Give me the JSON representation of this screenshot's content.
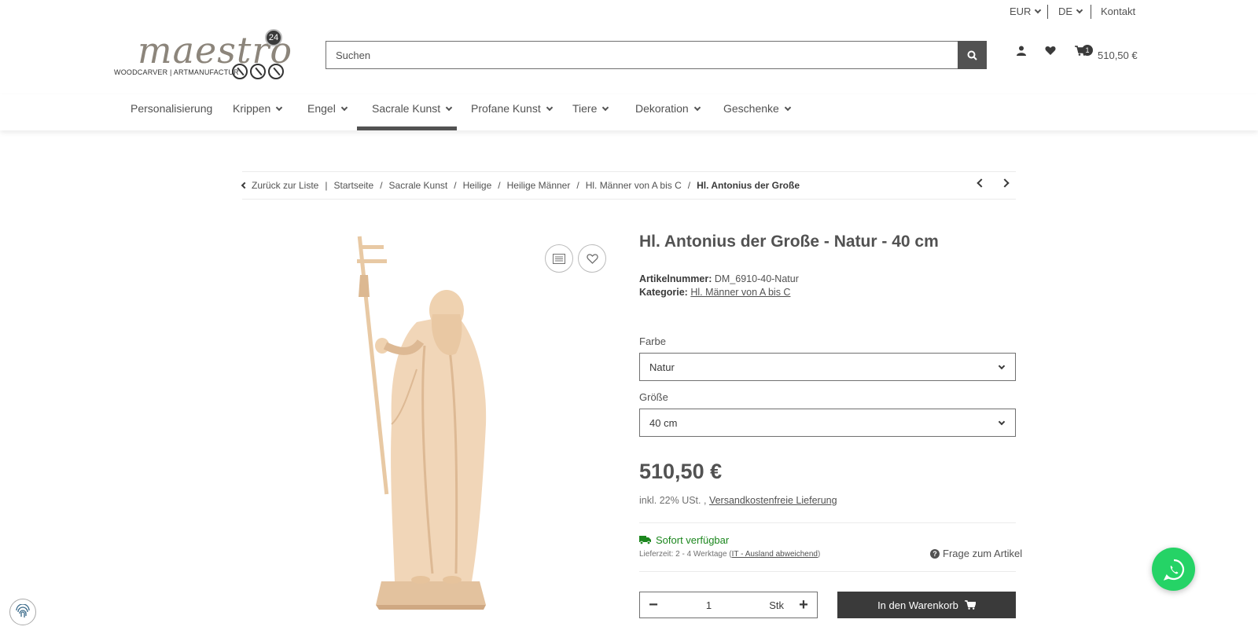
{
  "topbar": {
    "currency": "EUR",
    "language": "DE",
    "contact": "Kontakt"
  },
  "logo": {
    "script": "maestro",
    "badge": "24",
    "subline": "WOODCARVER | ARTMANUFACTUR"
  },
  "search": {
    "placeholder": "Suchen"
  },
  "header": {
    "cart_count": "1",
    "cart_total": "510,50 €"
  },
  "nav": {
    "items": [
      {
        "label": "Personalisierung"
      },
      {
        "label": "Krippen"
      },
      {
        "label": "Engel"
      },
      {
        "label": "Sacrale Kunst"
      },
      {
        "label": "Profane Kunst"
      },
      {
        "label": "Tiere"
      },
      {
        "label": "Dekoration"
      },
      {
        "label": "Geschenke"
      }
    ],
    "active": "Sacrale Kunst"
  },
  "breadcrumb": {
    "back": "Zurück zur Liste",
    "items": [
      "Startseite",
      "Sacrale Kunst",
      "Heilige",
      "Heilige Männer",
      "Hl. Männer von A bis C"
    ],
    "current": "Hl. Antonius der Große"
  },
  "product": {
    "title": "Hl. Antonius der Große - Natur - 40 cm",
    "sku_label": "Artikelnummer:",
    "sku": "DM_6910-40-Natur",
    "category_label": "Kategorie:",
    "category": "Hl. Männer von A bis C",
    "color_label": "Farbe",
    "color_value": "Natur",
    "size_label": "Größe",
    "size_value": "40 cm",
    "price": "510,50 €",
    "vat": "inkl. 22% USt. ,",
    "shipping": "Versandkostenfreie Lieferung",
    "availability": "Sofort verfügbar",
    "delivery_prefix": "Lieferzeit: 2 - 4 Werktage (",
    "delivery_link": "IT - Ausland abweichend",
    "delivery_suffix": ")",
    "question": "Frage zum Artikel",
    "quantity": "1",
    "unit": "Stk",
    "add_to_cart": "In den Warenkorb"
  },
  "colors": {
    "text": "#525252",
    "dark": "#3a3a3a",
    "available": "#1c871e",
    "whatsapp": "#25d366",
    "wood": "#f1d6b8"
  }
}
